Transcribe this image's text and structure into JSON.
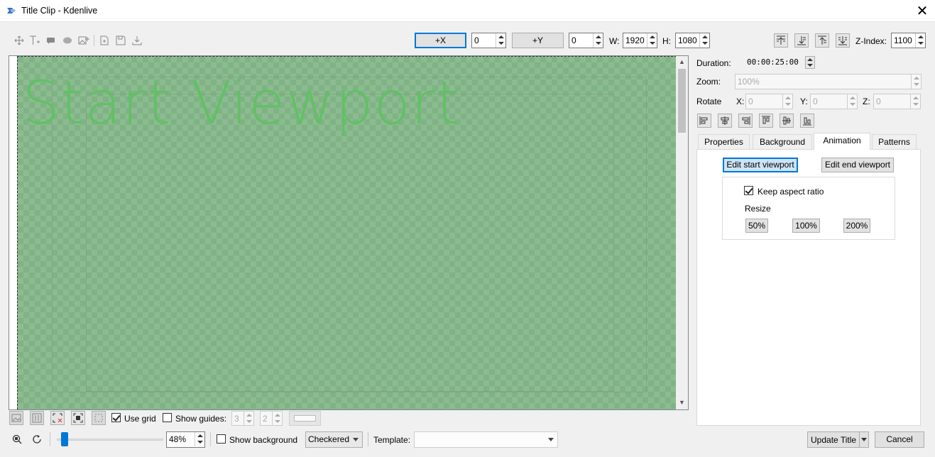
{
  "window": {
    "title": "Title Clip - Kdenlive",
    "close_glyph": "✕"
  },
  "toolbar": {
    "icons": [
      "select-move-icon",
      "add-text-icon",
      "add-rectangle-icon",
      "add-ellipse-icon",
      "add-image-icon",
      "open-document-icon",
      "save-as-icon",
      "download-icon"
    ],
    "plus_x_label": "+X",
    "x_value": "0",
    "plus_y_label": "+Y",
    "y_value": "0",
    "w_label": "W:",
    "w_value": "1920",
    "h_label": "H:",
    "h_value": "1080",
    "zindex_label": "Z-Index:",
    "zindex_value": "1100"
  },
  "canvas": {
    "viewport_text": "Start Viewport",
    "scroll_up": "▲",
    "scroll_down": "▼"
  },
  "side": {
    "duration_label": "Duration:",
    "duration_value": "00:00:25:00",
    "zoom_label": "Zoom:",
    "zoom_value": "100%",
    "rotate_label": "Rotate",
    "rx_label": "X:",
    "rx_value": "0",
    "ry_label": "Y:",
    "ry_value": "0",
    "rz_label": "Z:",
    "rz_value": "0",
    "tabs": [
      "Properties",
      "Background",
      "Animation",
      "Patterns"
    ],
    "edit_start": "Edit start viewport",
    "edit_end": "Edit end viewport",
    "keep_aspect": "Keep aspect ratio",
    "resize_label": "Resize",
    "resize_50": "50%",
    "resize_100": "100%",
    "resize_200": "200%"
  },
  "bottom": {
    "use_grid": "Use grid",
    "show_guides": "Show guides:",
    "guides_h": "3",
    "guides_v": "2",
    "zoom_value": "48%",
    "show_background": "Show background",
    "background_mode": "Checkered",
    "template_label": "Template:",
    "template_value": "",
    "update_title": "Update Title",
    "cancel": "Cancel"
  },
  "colors": {
    "accent": "#0078d7",
    "canvas_green": "#7fb385",
    "viewport_text": "#62c065"
  }
}
